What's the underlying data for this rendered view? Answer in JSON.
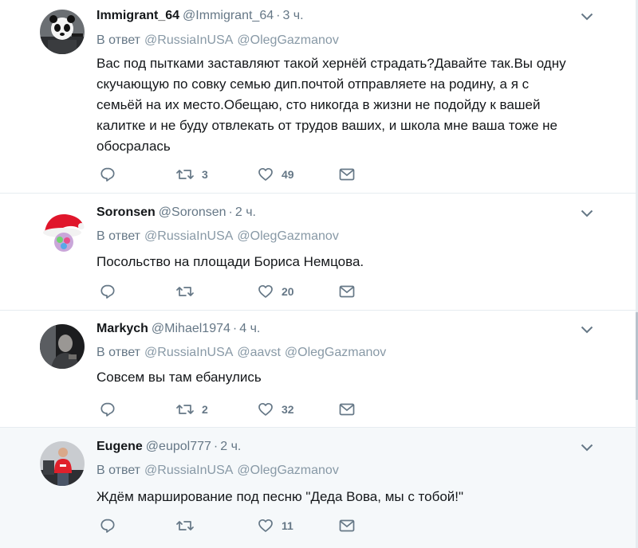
{
  "reply_prefix": "В ответ",
  "colors": {
    "secondary_text": "#657786",
    "mention": "#8899a6",
    "divider": "#e6ecf0",
    "highlight_bg": "#f5f8fa"
  },
  "tweets": [
    {
      "fullname": "Immigrant_64",
      "handle": "@Immigrant_64",
      "time": "3 ч.",
      "mentions": [
        "@RussiaInUSA",
        "@OlegGazmanov"
      ],
      "text": "Вас под пытками заставляют такой хернёй страдать?Давайте так.Вы одну скучающую по совку семью дип.почтой отправляете на родину, а я с семьёй на их место.Обещаю, сто никогда в жизни не подойду к вашей калитке и не буду отвлекать от трудов ваших, и школа мне ваша тоже не обосралась",
      "retweets": "3",
      "likes": "49",
      "avatar_icon": "panda-avatar"
    },
    {
      "fullname": "Soronsen",
      "handle": "@Soronsen",
      "time": "2 ч.",
      "mentions": [
        "@RussiaInUSA",
        "@OlegGazmanov"
      ],
      "text": "Посольство на площади Бориса Немцова.",
      "retweets": "",
      "likes": "20",
      "avatar_icon": "santa-hat-avatar"
    },
    {
      "fullname": "Markych",
      "handle": "@Mihael1974",
      "time": "4 ч.",
      "mentions": [
        "@RussiaInUSA",
        "@aavst",
        "@OlegGazmanov"
      ],
      "text": "Совсем вы там ебанулись",
      "retweets": "2",
      "likes": "32",
      "avatar_icon": "person-photo-avatar"
    },
    {
      "fullname": "Eugene",
      "handle": "@eupol777",
      "time": "2 ч.",
      "mentions": [
        "@RussiaInUSA",
        "@OlegGazmanov"
      ],
      "text": "Ждём марширование под песню \"Деда Вова, мы с тобой!\"",
      "retweets": "",
      "likes": "11",
      "avatar_icon": "person-red-shirt-avatar"
    }
  ]
}
